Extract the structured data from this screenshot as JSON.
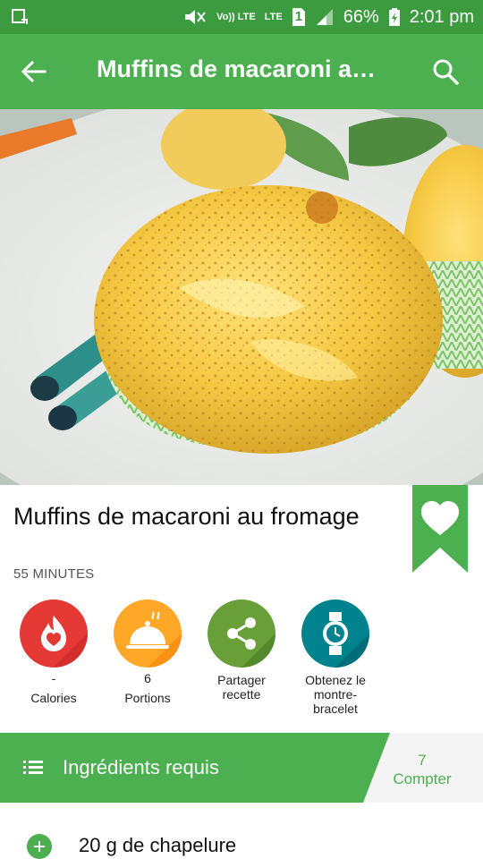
{
  "status_bar": {
    "volte_label": "Vo)) LTE",
    "lte_label": "LTE",
    "sim_label": "1",
    "battery": "66%",
    "time": "2:01 pm"
  },
  "app_bar": {
    "title": "Muffins de macaroni a…",
    "back_icon": "arrow-left-icon",
    "search_icon": "search-icon"
  },
  "recipe": {
    "title": "Muffins de macaroni au fromage",
    "duration": "55 MINUTES"
  },
  "actions": [
    {
      "value": "-",
      "label": "Calories",
      "color": "#e53935",
      "icon": "flame-heart-icon"
    },
    {
      "value": "6",
      "label": "Portions",
      "color": "#ffa726",
      "icon": "cloche-icon"
    },
    {
      "value": "",
      "label": "Partager recette",
      "color": "#689f38",
      "icon": "share-icon"
    },
    {
      "value": "",
      "label": "Obtenez le montre-bracelet",
      "color": "#00838f",
      "icon": "watch-icon"
    }
  ],
  "ingredients_header": {
    "title": "Ingrédients requis",
    "count_value": "7",
    "count_label": "Compter"
  },
  "ingredients": [
    {
      "text": "20 g de chapelure"
    }
  ],
  "colors": {
    "status_bar": "#3c9a3f",
    "app_bar": "#4caf50",
    "accent": "#4caf50"
  }
}
